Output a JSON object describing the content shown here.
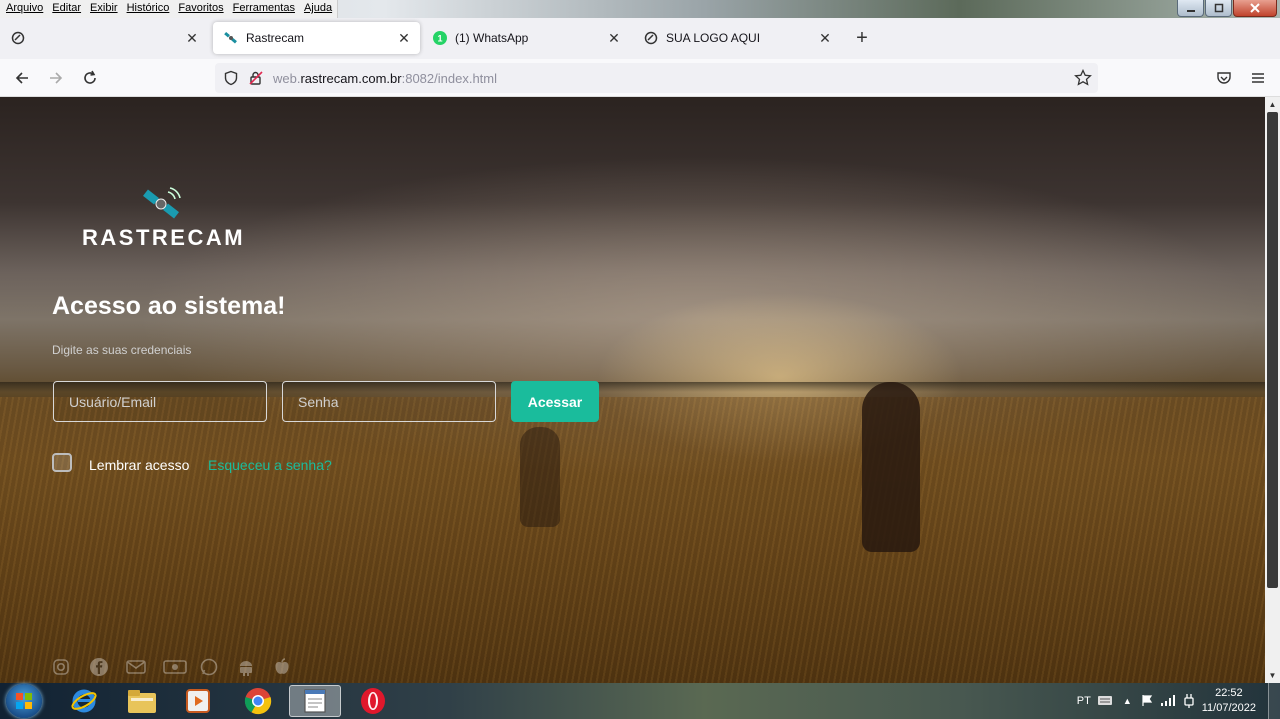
{
  "menu": [
    "Arquivo",
    "Editar",
    "Exibir",
    "Histórico",
    "Favoritos",
    "Ferramentas",
    "Ajuda"
  ],
  "tabs": [
    {
      "label": "",
      "icon": "firefox-default-icon",
      "active": false
    },
    {
      "label": "Rastrecam",
      "icon": "satellite-icon",
      "active": true
    },
    {
      "label": "(1) WhatsApp",
      "icon": "whatsapp-icon",
      "badge": "1",
      "active": false
    },
    {
      "label": "SUA LOGO AQUI",
      "icon": "firefox-default-icon",
      "active": false
    }
  ],
  "url": {
    "prefix": "web.",
    "host": "rastrecam.com.br",
    "suffix": ":8082/index.html"
  },
  "login": {
    "brand": "RASTRECAM",
    "title": "Acesso ao sistema!",
    "subtitle": "Digite as suas credenciais",
    "user_placeholder": "Usuário/Email",
    "password_placeholder": "Senha",
    "submit": "Acessar",
    "remember": "Lembrar acesso",
    "forgot": "Esqueceu a senha?"
  },
  "social_icons": [
    "instagram-icon",
    "facebook-icon",
    "email-icon",
    "money-icon",
    "whatsapp-icon",
    "android-icon",
    "apple-icon"
  ],
  "taskbar": {
    "apps": [
      "internet-explorer-icon",
      "file-explorer-icon",
      "media-player-icon",
      "chrome-icon",
      "notepad-icon",
      "opera-icon"
    ],
    "language": "PT",
    "time": "22:52",
    "date": "11/07/2022"
  },
  "colors": {
    "accent": "#1abc9c"
  }
}
